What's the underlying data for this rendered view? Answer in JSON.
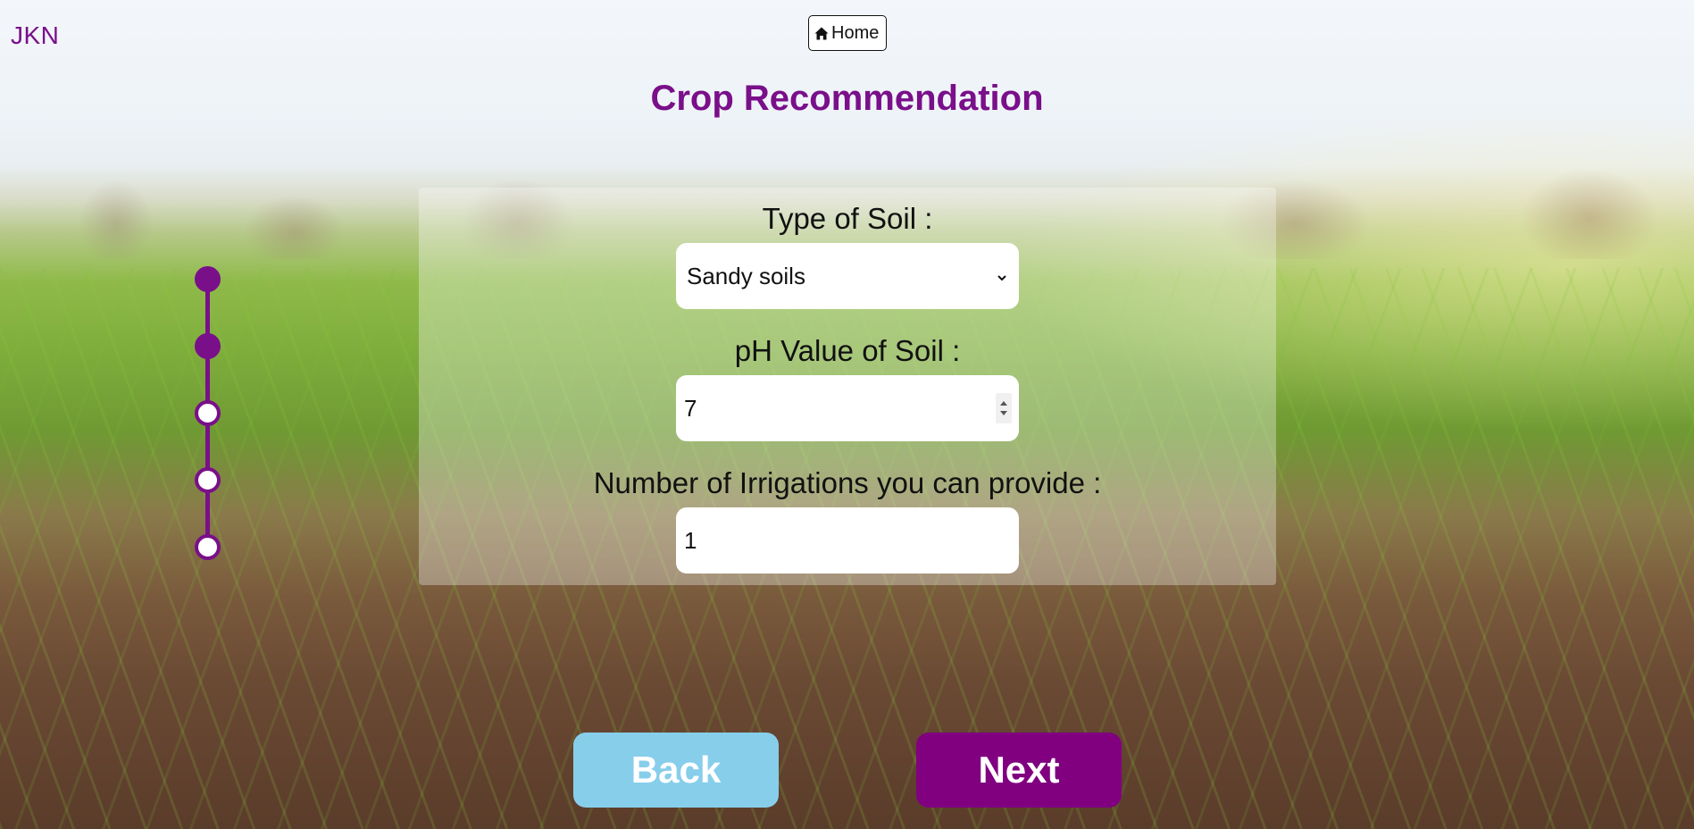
{
  "header": {
    "brand": "JKN",
    "home_label": "Home",
    "page_title": "Crop Recommendation"
  },
  "form": {
    "soil_type": {
      "label": "Type of Soil :",
      "selected": "Sandy soils"
    },
    "ph_value": {
      "label": "pH Value of Soil :",
      "value": "7"
    },
    "irrigations": {
      "label": "Number of Irrigations you can provide :",
      "value": "1"
    }
  },
  "progress": {
    "total_steps": 5,
    "completed_steps": 2
  },
  "actions": {
    "back_label": "Back",
    "next_label": "Next"
  },
  "colors": {
    "accent": "#7a0f8a",
    "next_button": "#800080",
    "back_button": "#87ceeb"
  },
  "icons": {
    "home": "home-icon",
    "select": "chevron-down-icon",
    "spinner": "number-spinner-icon"
  }
}
